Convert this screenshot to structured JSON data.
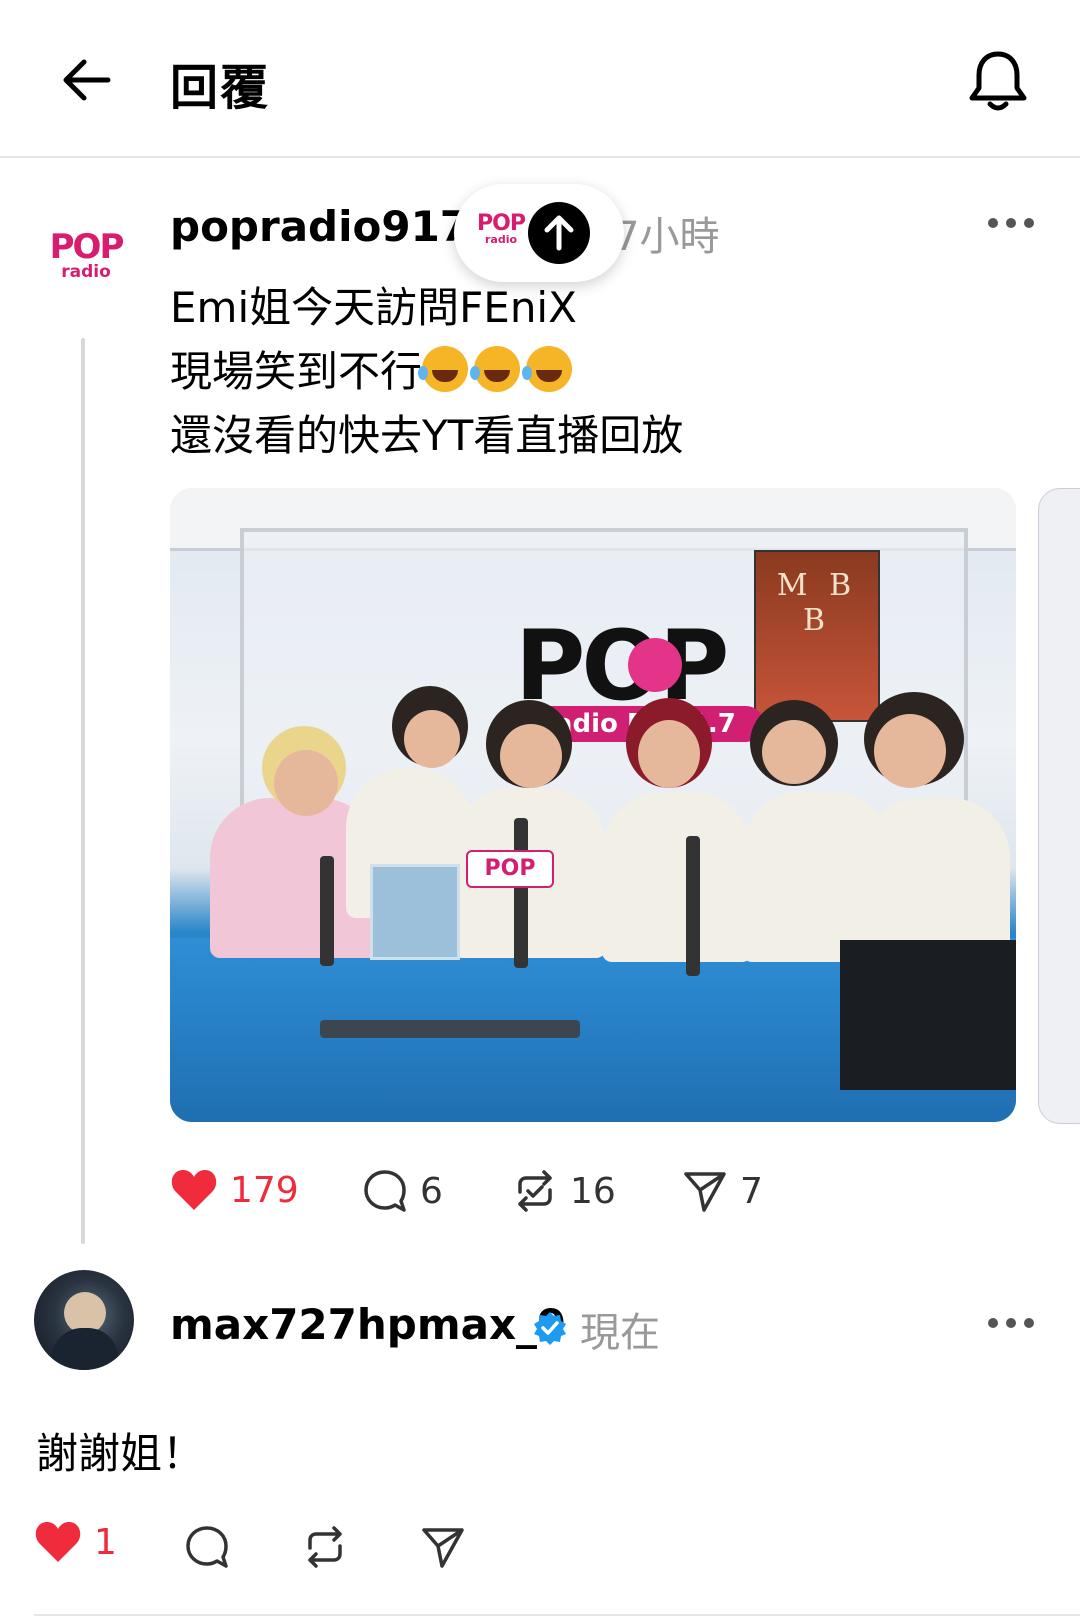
{
  "header": {
    "title": "回覆",
    "back_icon": "arrow-left-icon",
    "bell_icon": "bell-icon"
  },
  "post": {
    "username": "popradio917",
    "avatar_text_top": "POP",
    "avatar_text_bottom": "radio",
    "time": "7小時",
    "lines": [
      "Emi姐今天訪問FEniX",
      "現場笑到不行",
      "還沒看的快去YT看直播回放"
    ],
    "emoji": "rolling-on-floor-laughing",
    "emoji_count": 3,
    "photo": {
      "logo_big": "POP",
      "logo_band": "radio Fm91.7",
      "poster_text": "M B B",
      "mic_flag": "POP"
    },
    "actions": {
      "likes": "179",
      "comments": "6",
      "reposts": "16",
      "shares": "7"
    },
    "pill": {
      "logo_top": "POP",
      "logo_bottom": "radio"
    }
  },
  "reply": {
    "username": "max727hpmax_9",
    "time": "現在",
    "text": "謝謝姐！",
    "actions": {
      "likes": "1"
    }
  },
  "colors": {
    "like": "#ef2b3c",
    "brand": "#d81c6e",
    "verified": "#1d9bf0",
    "muted": "#999999"
  }
}
